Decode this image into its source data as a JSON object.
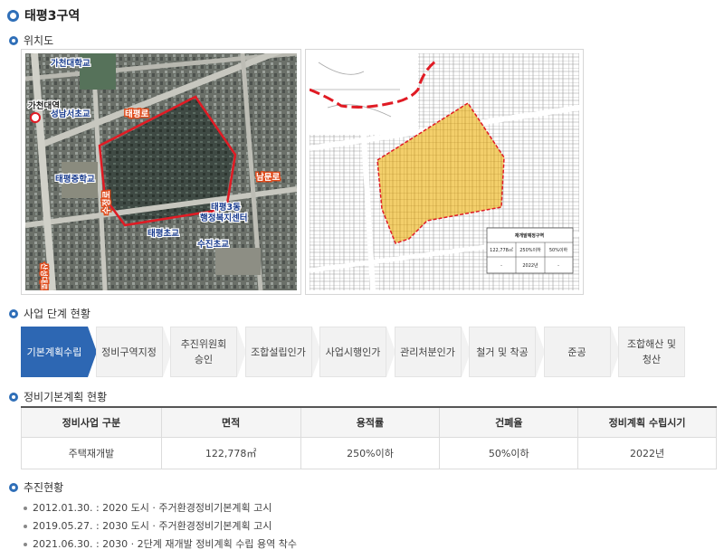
{
  "page": {
    "title": "태평3구역"
  },
  "sections": {
    "location": "위치도",
    "steps": "사업 단계 현황",
    "plan": "정비기본계획 현황",
    "progress": "추진현황"
  },
  "map_left": {
    "labels": {
      "gacheon_univ": "가천대학교",
      "gacheon_station": "가천대역",
      "seongnam_elem": "성남서초교",
      "taepyeong_ro1": "태평로",
      "taepyeong_middle": "태평중학교",
      "sujeong_ro": "수정로",
      "nammun_ro": "남문로",
      "taepyeong3_center": "태평3동",
      "taepyeong3_center2": "행정복지센터",
      "taepyeong_elem": "태평초교",
      "sujin_elem": "수진초교",
      "sanseong_daero": "산성대로"
    }
  },
  "map_right": {
    "table_title": "재개발예정구역",
    "cells": [
      "122,778㎡",
      "250%이하",
      "50%이하",
      "-",
      "2022년",
      "-"
    ]
  },
  "steps": [
    {
      "label": "기본계획수립",
      "active": true
    },
    {
      "label": "정비구역지정",
      "active": false
    },
    {
      "label": "추진위원회\n승인",
      "active": false
    },
    {
      "label": "조합설립인가",
      "active": false
    },
    {
      "label": "사업시행인가",
      "active": false
    },
    {
      "label": "관리처분인가",
      "active": false
    },
    {
      "label": "철거 및 착공",
      "active": false
    },
    {
      "label": "준공",
      "active": false
    },
    {
      "label": "조합해산 및\n청산",
      "active": false
    }
  ],
  "plan_table": {
    "headers": [
      "정비사업 구분",
      "면적",
      "용적률",
      "건폐율",
      "정비계획 수립시기"
    ],
    "row": [
      "주택재개발",
      "122,778㎡",
      "250%이하",
      "50%이하",
      "2022년"
    ]
  },
  "progress": [
    "2012.01.30. : 2020 도시 · 주거환경정비기본계획 고시",
    "2019.05.27. : 2030 도시 · 주거환경정비기본계획 고시",
    "2021.06.30. : 2030 · 2단계 재개발 정비계획 수립 용역 착수"
  ],
  "colors": {
    "accent": "#2d67b3",
    "boundary": "#e01b24",
    "zone_fill": "#f3cf6b"
  }
}
